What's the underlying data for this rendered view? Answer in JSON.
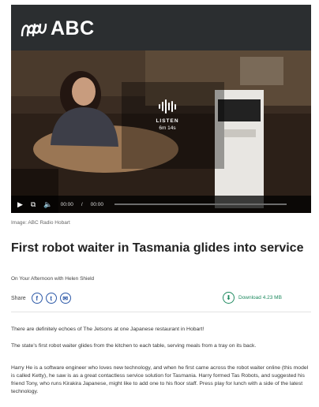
{
  "header": {
    "logo_text": "ABC",
    "logo_mark": "abc-lissajous-logo"
  },
  "player": {
    "listen_label": "LISTEN",
    "duration": "6m 14s",
    "current_time": "00:00",
    "total_time": "00:00",
    "progress": 0,
    "icons": [
      "play-icon",
      "cast-icon",
      "volume-icon"
    ]
  },
  "article": {
    "image_caption": "Image: ABC Radio Hobart",
    "title": "First robot waiter in Tasmania glides into service",
    "program": "On Your Afternoon with Helen Shield",
    "share_label": "Share",
    "share_icons": [
      "facebook-icon",
      "twitter-icon",
      "email-icon"
    ],
    "download_label": "Download 4.23 MB",
    "paragraphs": [
      "There are definitely echoes of The Jetsons at one Japanese restaurant in Hobart!",
      "The state's first robot waiter glides from the kitchen to each table, serving meals from a tray on its back.",
      "Harry He is a software engineer who loves new technology, and when he first came across the robot waiter online (this model is called Ketty), he saw is as a great contactless service solution for Tasmania. Harry formed Tas Robots, and suggested his friend Tony, who runs Kirakira Japanese, might like to add one to his floor staff. Press play for lunch with a side of the latest technology."
    ]
  },
  "colors": {
    "header_bg": "#2b2e30",
    "share_blue": "#2e5aa8",
    "download_green": "#1e8a5f"
  }
}
